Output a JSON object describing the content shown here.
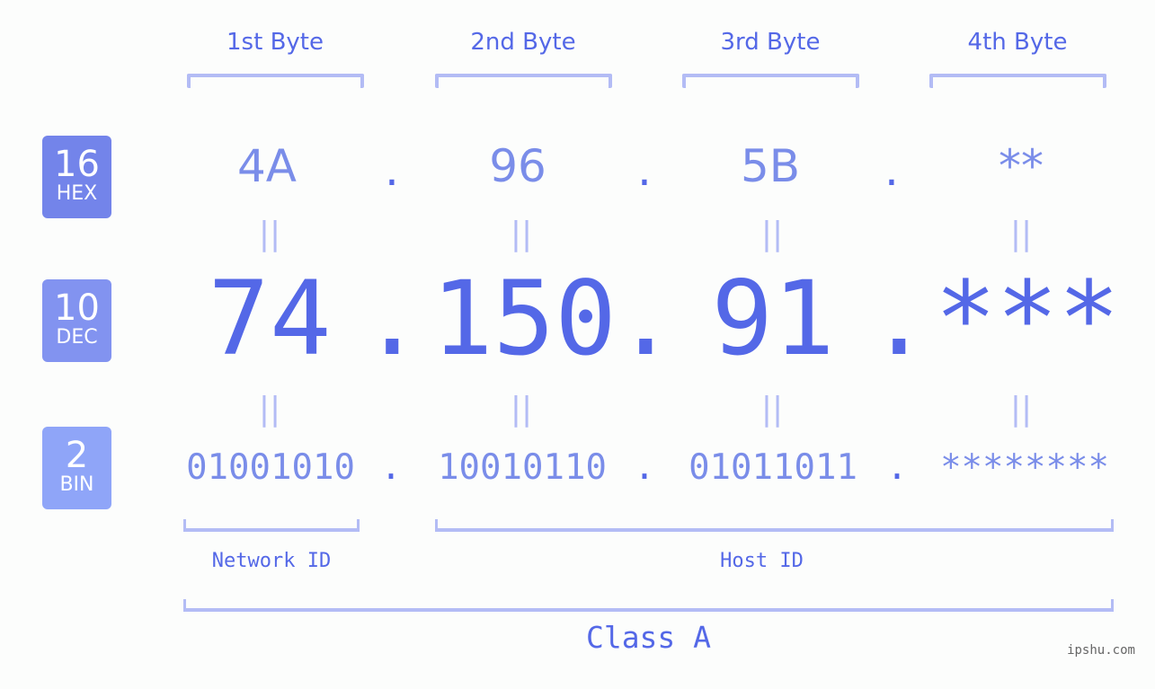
{
  "byte_headers": [
    "1st Byte",
    "2nd Byte",
    "3rd Byte",
    "4th Byte"
  ],
  "badges": {
    "hex": {
      "number": "16",
      "label": "HEX",
      "color": "#7384ea"
    },
    "dec": {
      "number": "10",
      "label": "DEC",
      "color": "#8293f0"
    },
    "bin": {
      "number": "2",
      "label": "BIN",
      "color": "#8fa5f8"
    }
  },
  "separator": ".",
  "equals_symbol": "||",
  "hex_values": [
    "4A",
    "96",
    "5B",
    "**"
  ],
  "dec_values": [
    "74",
    "150",
    "91",
    "***"
  ],
  "bin_values": [
    "01001010",
    "10010110",
    "01011011",
    "********"
  ],
  "network_id_label": "Network ID",
  "host_id_label": "Host ID",
  "class_label": "Class A",
  "watermark": "ipshu.com",
  "colors": {
    "primary": "#5468e7",
    "secondary": "#7a8de9",
    "bracket": "#b3bcf5",
    "background": "#fcfdfc"
  }
}
